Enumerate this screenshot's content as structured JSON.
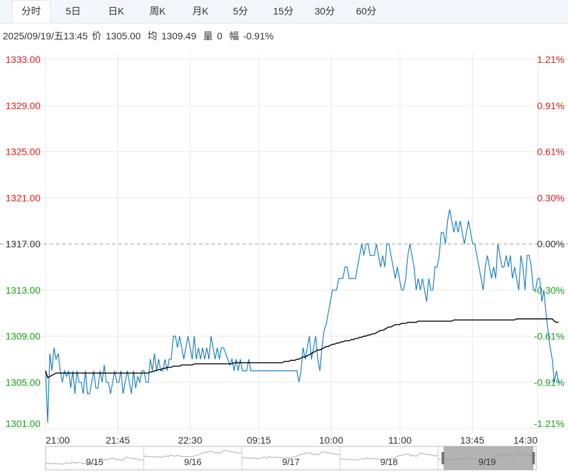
{
  "tabs": [
    "分时",
    "5日",
    "日K",
    "周K",
    "月K",
    "5分",
    "15分",
    "30分",
    "60分"
  ],
  "active_tab": 0,
  "info": {
    "datetime": "2025/09/19/五13:45",
    "price_label": "价",
    "price": "1305.00",
    "avg_label": "均",
    "avg": "1309.49",
    "volume_label": "量",
    "volume": "0",
    "change_label": "幅",
    "change": "-0.91%"
  },
  "colors": {
    "price_line": "#1b7fc4",
    "avg_line": "#000000",
    "up": "#e02020",
    "down": "#1a9e1a",
    "grid": "#e8e8e8"
  },
  "chart_data": {
    "type": "line",
    "title": "",
    "ylim": [
      1301.0,
      1333.0
    ],
    "reference_price": 1317.0,
    "left_ticks": [
      "1333.00",
      "1329.00",
      "1325.00",
      "1321.00",
      "1317.00",
      "1313.00",
      "1309.00",
      "1305.00",
      "1301.00"
    ],
    "right_ticks": [
      "1.21%",
      "0.91%",
      "0.61%",
      "0.30%",
      "0.00%",
      "-0.30%",
      "-0.61%",
      "-0.91%",
      "-1.21%"
    ],
    "x_ticks": [
      "21:00",
      "21:45",
      "22:30",
      "09:15",
      "10:00",
      "11:00",
      "13:45",
      "14:30"
    ],
    "total_points": 236,
    "series": [
      {
        "values": [
          1306,
          1301.5,
          1307.5,
          1306,
          1308,
          1307,
          1307.5,
          1306,
          1305,
          1306,
          1305.5,
          1306,
          1304.5,
          1306,
          1304,
          1306,
          1305,
          1305,
          1304,
          1306,
          1304,
          1304,
          1305,
          1306,
          1304.5,
          1304.5,
          1306,
          1305,
          1306.5,
          1305,
          1305,
          1304,
          1305,
          1306,
          1305,
          1305,
          1306,
          1304,
          1305,
          1306,
          1305,
          1304,
          1306,
          1304.5,
          1305.5,
          1305,
          1306,
          1306,
          1305,
          1305,
          1307,
          1306,
          1307.5,
          1306,
          1307,
          1306,
          1306,
          1307,
          1306,
          1307,
          1307,
          1309,
          1309,
          1308,
          1309,
          1308,
          1307,
          1308,
          1309,
          1308,
          1307,
          1309,
          1307,
          1308,
          1307,
          1308,
          1307,
          1308,
          1307,
          1309,
          1308,
          1307,
          1308,
          1307,
          1308,
          1308,
          1307.5,
          1307,
          1306.5,
          1307,
          1306,
          1307,
          1306,
          1307,
          1306,
          1306,
          1306,
          1307,
          1306,
          1306,
          1306,
          1306,
          1306,
          1306,
          1306,
          1306,
          1306,
          1306,
          1306,
          1306,
          1306,
          1306,
          1306,
          1306,
          1306,
          1306,
          1306,
          1306,
          1306,
          1306,
          1306,
          1305,
          1306,
          1308,
          1307,
          1308,
          1309,
          1307,
          1308,
          1309,
          1307,
          1306,
          1308,
          1309.5,
          1310,
          1311,
          1312,
          1313,
          1313,
          1313,
          1314,
          1314,
          1314,
          1315,
          1315,
          1314,
          1314,
          1314,
          1314,
          1315,
          1316,
          1317,
          1316,
          1317,
          1317,
          1316,
          1316,
          1316,
          1317,
          1316,
          1315,
          1316,
          1315,
          1317,
          1317,
          1316,
          1315,
          1314,
          1315,
          1314,
          1313,
          1313,
          1314,
          1316,
          1317,
          1316,
          1315,
          1313,
          1314,
          1313,
          1314,
          1313,
          1312,
          1314,
          1313,
          1313,
          1315,
          1315,
          1316,
          1318,
          1318,
          1317,
          1319,
          1320,
          1319,
          1318,
          1319,
          1318,
          1319,
          1318,
          1317,
          1318,
          1319,
          1318,
          1317,
          1317,
          1316,
          1315,
          1314,
          1313,
          1315,
          1316,
          1315,
          1314,
          1315,
          1314,
          1317,
          1316,
          1315,
          1315,
          1316,
          1315,
          1316,
          1314,
          1315,
          1314,
          1313,
          1316,
          1315,
          1313,
          1316,
          1316,
          1315,
          1313,
          1313,
          1314,
          1314,
          1312,
          1313,
          1311,
          1309.5,
          1308,
          1307,
          1305,
          1306,
          1305,
          1305
        ],
        "avg": [
          1306,
          1305.4,
          1305.5,
          1305.6,
          1305.7,
          1305.8,
          1305.8,
          1305.8,
          1305.8,
          1305.8,
          1305.8,
          1305.8,
          1305.8,
          1305.8,
          1305.8,
          1305.8,
          1305.8,
          1305.8,
          1305.8,
          1305.8,
          1305.8,
          1305.8,
          1305.8,
          1305.8,
          1305.8,
          1305.8,
          1305.8,
          1305.8,
          1305.8,
          1305.8,
          1305.8,
          1305.8,
          1305.8,
          1305.8,
          1305.8,
          1305.8,
          1305.8,
          1305.8,
          1305.8,
          1305.8,
          1305.8,
          1305.8,
          1305.8,
          1305.8,
          1305.8,
          1305.8,
          1305.8,
          1305.8,
          1305.8,
          1305.8,
          1305.9,
          1305.9,
          1306,
          1306,
          1306.1,
          1306.1,
          1306.2,
          1306.2,
          1306.3,
          1306.3,
          1306.3,
          1306.4,
          1306.4,
          1306.4,
          1306.4,
          1306.5,
          1306.5,
          1306.5,
          1306.5,
          1306.5,
          1306.5,
          1306.6,
          1306.6,
          1306.6,
          1306.6,
          1306.6,
          1306.6,
          1306.6,
          1306.6,
          1306.6,
          1306.6,
          1306.6,
          1306.6,
          1306.6,
          1306.6,
          1306.6,
          1306.6,
          1306.6,
          1306.6,
          1306.6,
          1306.7,
          1306.7,
          1306.7,
          1306.7,
          1306.7,
          1306.7,
          1306.7,
          1306.7,
          1306.7,
          1306.7,
          1306.7,
          1306.7,
          1306.7,
          1306.7,
          1306.7,
          1306.7,
          1306.7,
          1306.7,
          1306.7,
          1306.7,
          1306.7,
          1306.7,
          1306.7,
          1306.7,
          1306.8,
          1306.8,
          1306.8,
          1306.9,
          1306.9,
          1306.9,
          1307,
          1307,
          1307.1,
          1307.2,
          1307.2,
          1307.3,
          1307.4,
          1307.5,
          1307.6,
          1307.7,
          1307.8,
          1307.8,
          1307.9,
          1308,
          1308.1,
          1308.1,
          1308.2,
          1308.3,
          1308.3,
          1308.4,
          1308.4,
          1308.5,
          1308.5,
          1308.6,
          1308.6,
          1308.6,
          1308.7,
          1308.7,
          1308.8,
          1308.8,
          1308.9,
          1308.9,
          1309,
          1309,
          1309.1,
          1309.1,
          1309.2,
          1309.2,
          1309.3,
          1309.4,
          1309.5,
          1309.5,
          1309.6,
          1309.7,
          1309.8,
          1309.8,
          1309.9,
          1310,
          1310,
          1310,
          1310.1,
          1310.1,
          1310.1,
          1310.2,
          1310.2,
          1310.2,
          1310.2,
          1310.2,
          1310.3,
          1310.3,
          1310.3,
          1310.3,
          1310.3,
          1310.3,
          1310.3,
          1310.3,
          1310.3,
          1310.3,
          1310.3,
          1310.3,
          1310.3,
          1310.3,
          1310.3,
          1310.3,
          1310.3,
          1310.4,
          1310.4,
          1310.4,
          1310.4,
          1310.4,
          1310.4,
          1310.4,
          1310.4,
          1310.4,
          1310.4,
          1310.4,
          1310.4,
          1310.4,
          1310.4,
          1310.4,
          1310.4,
          1310.4,
          1310.4,
          1310.4,
          1310.4,
          1310.4,
          1310.4,
          1310.4,
          1310.4,
          1310.4,
          1310.4,
          1310.4,
          1310.4,
          1310.4,
          1310.4,
          1310.5,
          1310.5,
          1310.5,
          1310.5,
          1310.5,
          1310.5,
          1310.5,
          1310.5,
          1310.5,
          1310.5,
          1310.5,
          1310.5,
          1310.5,
          1310.5,
          1310.5,
          1310.5,
          1310.5,
          1310.5,
          1310.3,
          1310.2,
          1310.2
        ]
      }
    ]
  },
  "navigator": {
    "days": [
      "9/15",
      "9/16",
      "9/17",
      "9/18",
      "9/19"
    ]
  }
}
